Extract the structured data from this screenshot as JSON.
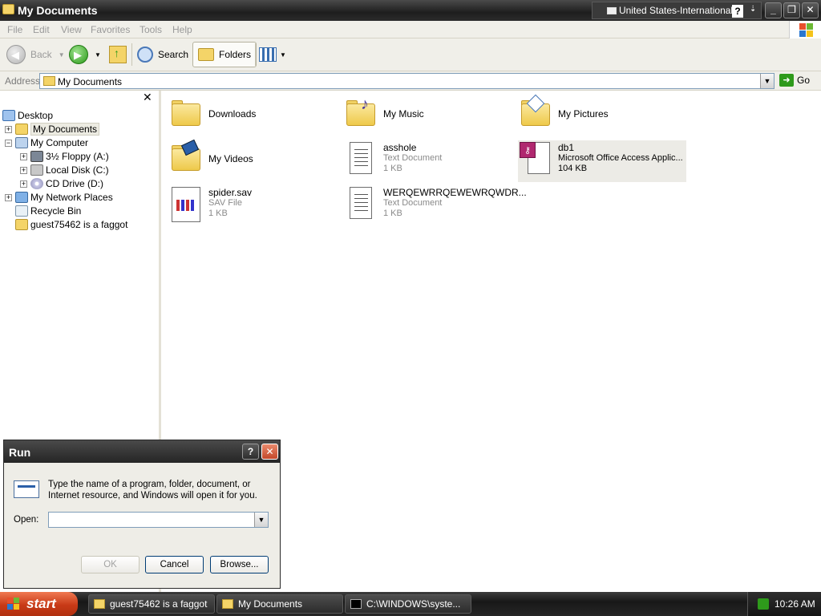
{
  "window": {
    "title": "My Documents",
    "language": "United States-International",
    "help_glyph": "?",
    "options_glyph": "⇣",
    "min_glyph": "_",
    "max_glyph": "❐",
    "close_glyph": "✕"
  },
  "menu": [
    "File",
    "Edit",
    "View",
    "Favorites",
    "Tools",
    "Help"
  ],
  "toolbar": {
    "back": "Back",
    "search": "Search",
    "folders": "Folders"
  },
  "address": {
    "label": "Address",
    "value": "My Documents",
    "go": "Go"
  },
  "tree": [
    {
      "label": "Desktop",
      "icon": "desktop-icon",
      "level": 0,
      "expander": ""
    },
    {
      "label": "My Documents",
      "icon": "folder-icon",
      "level": 1,
      "expander": "+",
      "selected": true
    },
    {
      "label": "My Computer",
      "icon": "computer-icon",
      "level": 1,
      "expander": "−"
    },
    {
      "label": "3½ Floppy (A:)",
      "icon": "floppy-icon",
      "level": 2,
      "expander": "+"
    },
    {
      "label": "Local Disk (C:)",
      "icon": "disk-icon",
      "level": 2,
      "expander": "+"
    },
    {
      "label": "CD Drive (D:)",
      "icon": "cd-icon",
      "level": 2,
      "expander": "+"
    },
    {
      "label": "My Network Places",
      "icon": "network-icon",
      "level": 1,
      "expander": "+"
    },
    {
      "label": "Recycle Bin",
      "icon": "recycle-bin-icon",
      "level": 1,
      "expander": ""
    },
    {
      "label": "guest75462 is a faggot",
      "icon": "folder-icon",
      "level": 1,
      "expander": ""
    }
  ],
  "items": [
    {
      "name": "Downloads",
      "type": "",
      "size": "",
      "icon": "folder-icon"
    },
    {
      "name": "My Music",
      "type": "",
      "size": "",
      "icon": "music-folder-icon"
    },
    {
      "name": "My Pictures",
      "type": "",
      "size": "",
      "icon": "pictures-folder-icon"
    },
    {
      "name": "My Videos",
      "type": "",
      "size": "",
      "icon": "videos-folder-icon"
    },
    {
      "name": "asshole",
      "type": "Text Document",
      "size": "1 KB",
      "icon": "text-document-icon"
    },
    {
      "name": "db1",
      "type": "Microsoft Office Access Applic...",
      "size": "104 KB",
      "icon": "access-database-icon"
    },
    {
      "name": "spider.sav",
      "type": "SAV File",
      "size": "1 KB",
      "icon": "sav-file-icon"
    },
    {
      "name": "WERQEWRRQEWEWRQWDR...",
      "type": "Text Document",
      "size": "1 KB",
      "icon": "text-document-icon"
    }
  ],
  "run_dialog": {
    "title": "Run",
    "description": "Type the name of a program, folder, document, or Internet resource, and Windows will open it for you.",
    "open_label": "Open:",
    "open_value": "",
    "ok": "OK",
    "cancel": "Cancel",
    "browse": "Browse..."
  },
  "taskbar": {
    "start": "start",
    "tasks": [
      {
        "label": "guest75462 is a faggot",
        "icon": "folder-icon"
      },
      {
        "label": "My Documents",
        "icon": "folder-icon"
      },
      {
        "label": "C:\\WINDOWS\\syste...",
        "icon": "command-prompt-icon"
      }
    ],
    "clock": "10:26 AM"
  },
  "colors": {
    "accent_green": "#2e9a1b",
    "start_red": "#c83a17",
    "titlebar_dark": "#1e1e1e"
  }
}
